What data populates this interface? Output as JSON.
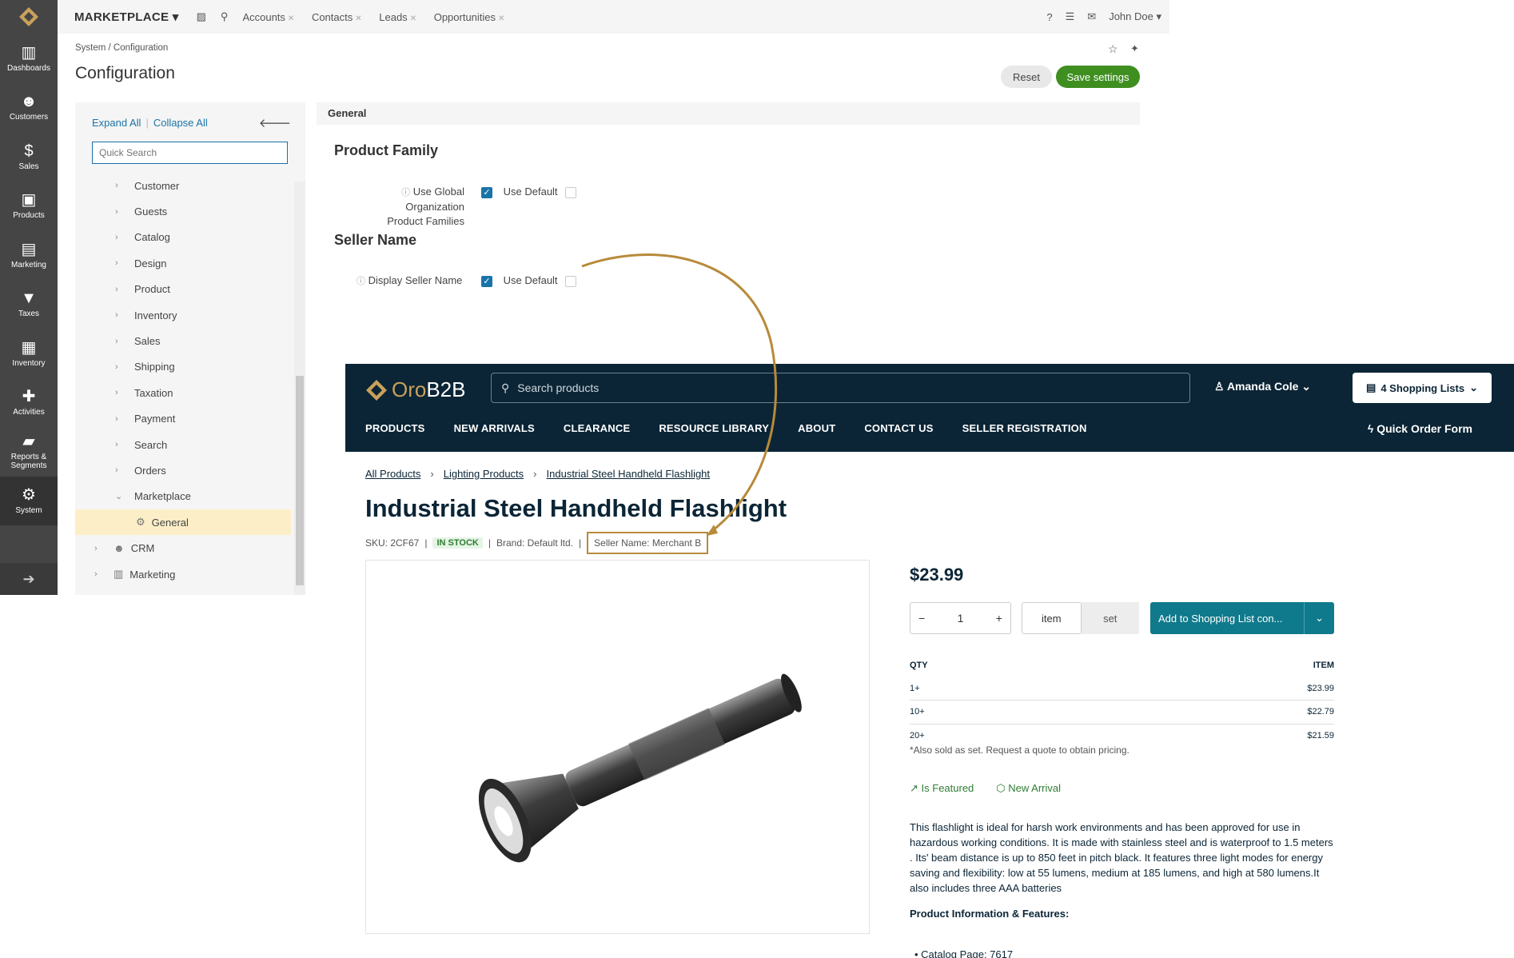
{
  "admin": {
    "sidebar": [
      {
        "label": "Dashboards",
        "icon": "bar-chart-icon"
      },
      {
        "label": "Customers",
        "icon": "users-icon"
      },
      {
        "label": "Sales",
        "icon": "dollar-icon"
      },
      {
        "label": "Products",
        "icon": "briefcase-icon"
      },
      {
        "label": "Marketing",
        "icon": "book-icon"
      },
      {
        "label": "Taxes",
        "icon": "filter-icon"
      },
      {
        "label": "Inventory",
        "icon": "building-icon"
      },
      {
        "label": "Activities",
        "icon": "puzzle-icon"
      },
      {
        "label": "Reports & Segments",
        "icon": "folder-icon"
      },
      {
        "label": "System",
        "icon": "gear-icon"
      }
    ],
    "topbar": {
      "brand": "MARKETPLACE",
      "tabs": [
        "Accounts",
        "Contacts",
        "Leads",
        "Opportunities"
      ],
      "user": "John Doe"
    },
    "breadcrumb": "System / Configuration",
    "title": "Configuration",
    "reset_label": "Reset",
    "save_label": "Save settings",
    "tree": {
      "expand_all": "Expand All",
      "collapse_all": "Collapse All",
      "search_placeholder": "Quick Search",
      "items": [
        "Customer",
        "Guests",
        "Catalog",
        "Design",
        "Product",
        "Inventory",
        "Sales",
        "Shipping",
        "Taxation",
        "Payment",
        "Search",
        "Orders"
      ],
      "open_item": "Marketplace",
      "selected_item": "General",
      "root_items": [
        "CRM",
        "Marketing"
      ]
    },
    "panel": {
      "header": "General",
      "section1": "Product Family",
      "field1_line1": "Use Global Organization",
      "field1_line2": "Product Families",
      "section2": "Seller Name",
      "field2": "Display Seller Name",
      "use_default": "Use Default"
    }
  },
  "store": {
    "logo_oro": "Oro",
    "logo_b2b": "B2B",
    "search_placeholder": "Search products",
    "user": "Amanda Cole",
    "shopping_lists": "4 Shopping Lists",
    "nav": [
      "PRODUCTS",
      "NEW ARRIVALS",
      "CLEARANCE",
      "RESOURCE LIBRARY",
      "ABOUT",
      "CONTACT US",
      "SELLER REGISTRATION"
    ],
    "quick_order": "Quick Order Form",
    "breadcrumb": [
      "All Products",
      "Lighting Products",
      "Industrial Steel Handheld Flashlight"
    ],
    "product_title": "Industrial Steel Handheld Flashlight",
    "sku": "SKU: 2CF67",
    "stock": "IN STOCK",
    "brand": "Brand: Default ltd.",
    "seller": "Seller Name: Merchant B",
    "price": "$23.99",
    "qty": "1",
    "unit_item": "item",
    "unit_set": "set",
    "add_button": "Add to Shopping List con...",
    "price_table": {
      "col_qty": "QTY",
      "col_item": "ITEM",
      "rows": [
        [
          "1+",
          "$23.99"
        ],
        [
          "10+",
          "$22.79"
        ],
        [
          "20+",
          "$21.59"
        ]
      ]
    },
    "also_sold": "*Also sold as set. Request a quote to obtain pricing.",
    "featured": "Is Featured",
    "new_arrival": "New Arrival",
    "description": "This flashlight is ideal for harsh work environments and has been approved for use in hazardous working conditions. It is made with stainless steel and is waterproof to 1.5 meters . Its' beam distance is up to 850 feet in pitch black. It features three light modes for energy saving and flexibility: low at 55 lumens, medium at 185 lumens, and high at 580 lumens.It also includes three AAA batteries",
    "product_info": "Product Information & Features:",
    "catalog_page": "Catalog Page: 7617"
  },
  "colors": {
    "accent": "#1a73a8",
    "save": "#3f8f20",
    "store_header": "#0b2536",
    "highlight": "#b88a3a"
  }
}
